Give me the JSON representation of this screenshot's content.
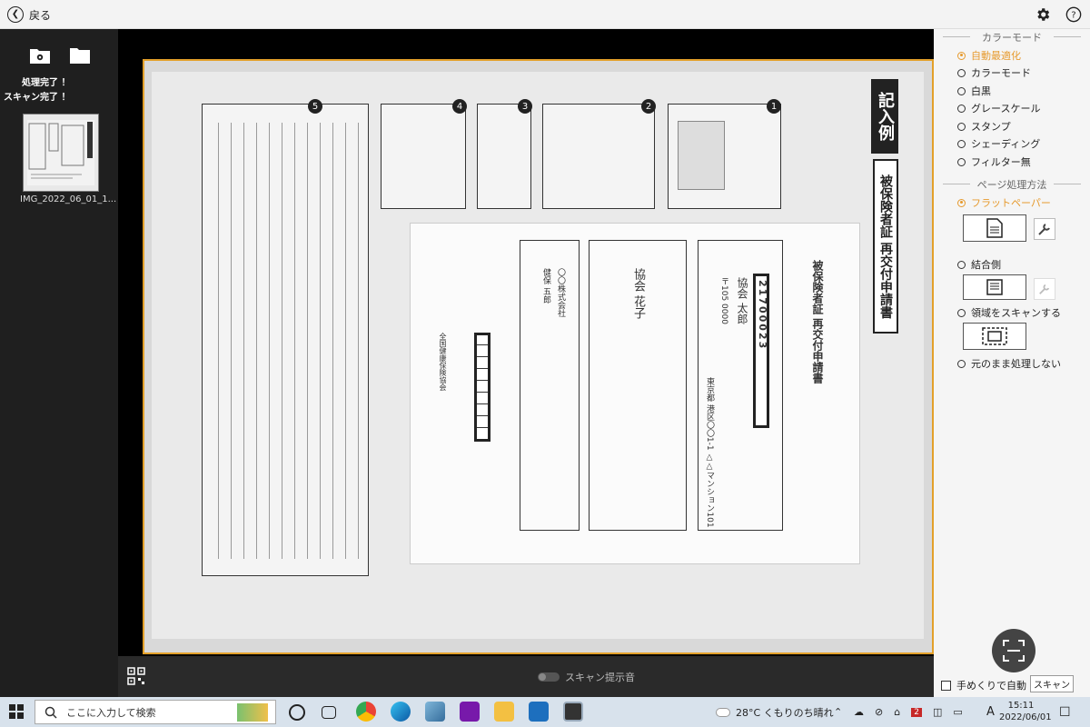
{
  "topbar": {
    "back_label": "戻る",
    "settings_icon": "gear-icon",
    "help_icon": "help-icon"
  },
  "left_panel": {
    "status_processed": "処理完了 ！",
    "status_scanned": "スキャン完了 ！",
    "thumbnail_label": "IMG_2022_06_01_1..."
  },
  "document": {
    "title": "記入例",
    "subtitle": "被保険者証 再交付申請書",
    "form_title": "被保険者証 再交付申請書",
    "insured_name": "協会 太郎",
    "postal": "〒105 0000",
    "address": "東京都 港区〇〇1-1 △△マンション101",
    "recipient_name": "協会 花子",
    "company": "〇〇株式会社",
    "manager": "健保 五郎",
    "number_box": "21700023",
    "number_box2": "21",
    "date_box": "6110122",
    "association": "全国健康保険協会"
  },
  "bottombar": {
    "scan_prompt_label": "スキャン提示音"
  },
  "right_panel": {
    "color_mode_title": "カラーモード",
    "color_options": [
      "自動最適化",
      "カラーモード",
      "白黒",
      "グレースケール",
      "スタンプ",
      "シェーディング",
      "フィルター無"
    ],
    "color_selected": "自動最適化",
    "page_method_title": "ページ処理方法",
    "page_options": [
      "フラットペーパー",
      "結合側",
      "領域をスキャンする",
      "元のまま処理しない"
    ],
    "page_selected": "フラットペーパー",
    "manual_page_label": "手めくりで自動",
    "scan_tooltip": "スキャン"
  },
  "taskbar": {
    "search_placeholder": "ここに入力して検索",
    "weather": "28°C くもりのち晴れ",
    "ime": "A",
    "time": "15:11",
    "date": "2022/06/01",
    "notification_count": "2"
  },
  "colors": {
    "accent": "#e69a2e",
    "frame": "#e3a02a"
  }
}
